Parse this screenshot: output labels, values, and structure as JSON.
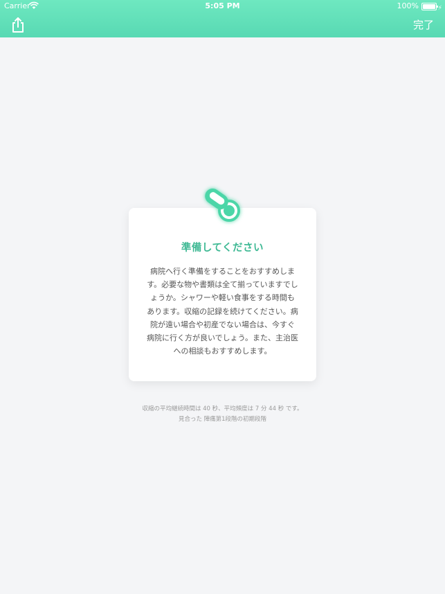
{
  "status_bar": {
    "carrier": "Carrier",
    "time": "5:05 PM",
    "battery": "100%"
  },
  "nav": {
    "share_icon": "share-icon",
    "done_label": "完了"
  },
  "card": {
    "icon": "pacifier-icon",
    "title": "準備してください",
    "body": "病院へ行く準備をすることをおすすめします。必要な物や書類は全て揃っていますでしょうか。シャワーや軽い食事をする時間もあります。収縮の記録を続けてください。病院が遠い場合や初産でない場合は、今すぐ病院に行く方が良いでしょう。また、主治医への相談もおすすめします。"
  },
  "stats": {
    "line1": "収縮の平均継続時間は 40 秒、平均頻度は 7 分 44 秒 です。",
    "line2": "見合った 陣痛第1段階の初期段階"
  },
  "colors": {
    "accent": "#3fb994",
    "header_top": "#6ee8c0",
    "header_bottom": "#58d9b3"
  }
}
